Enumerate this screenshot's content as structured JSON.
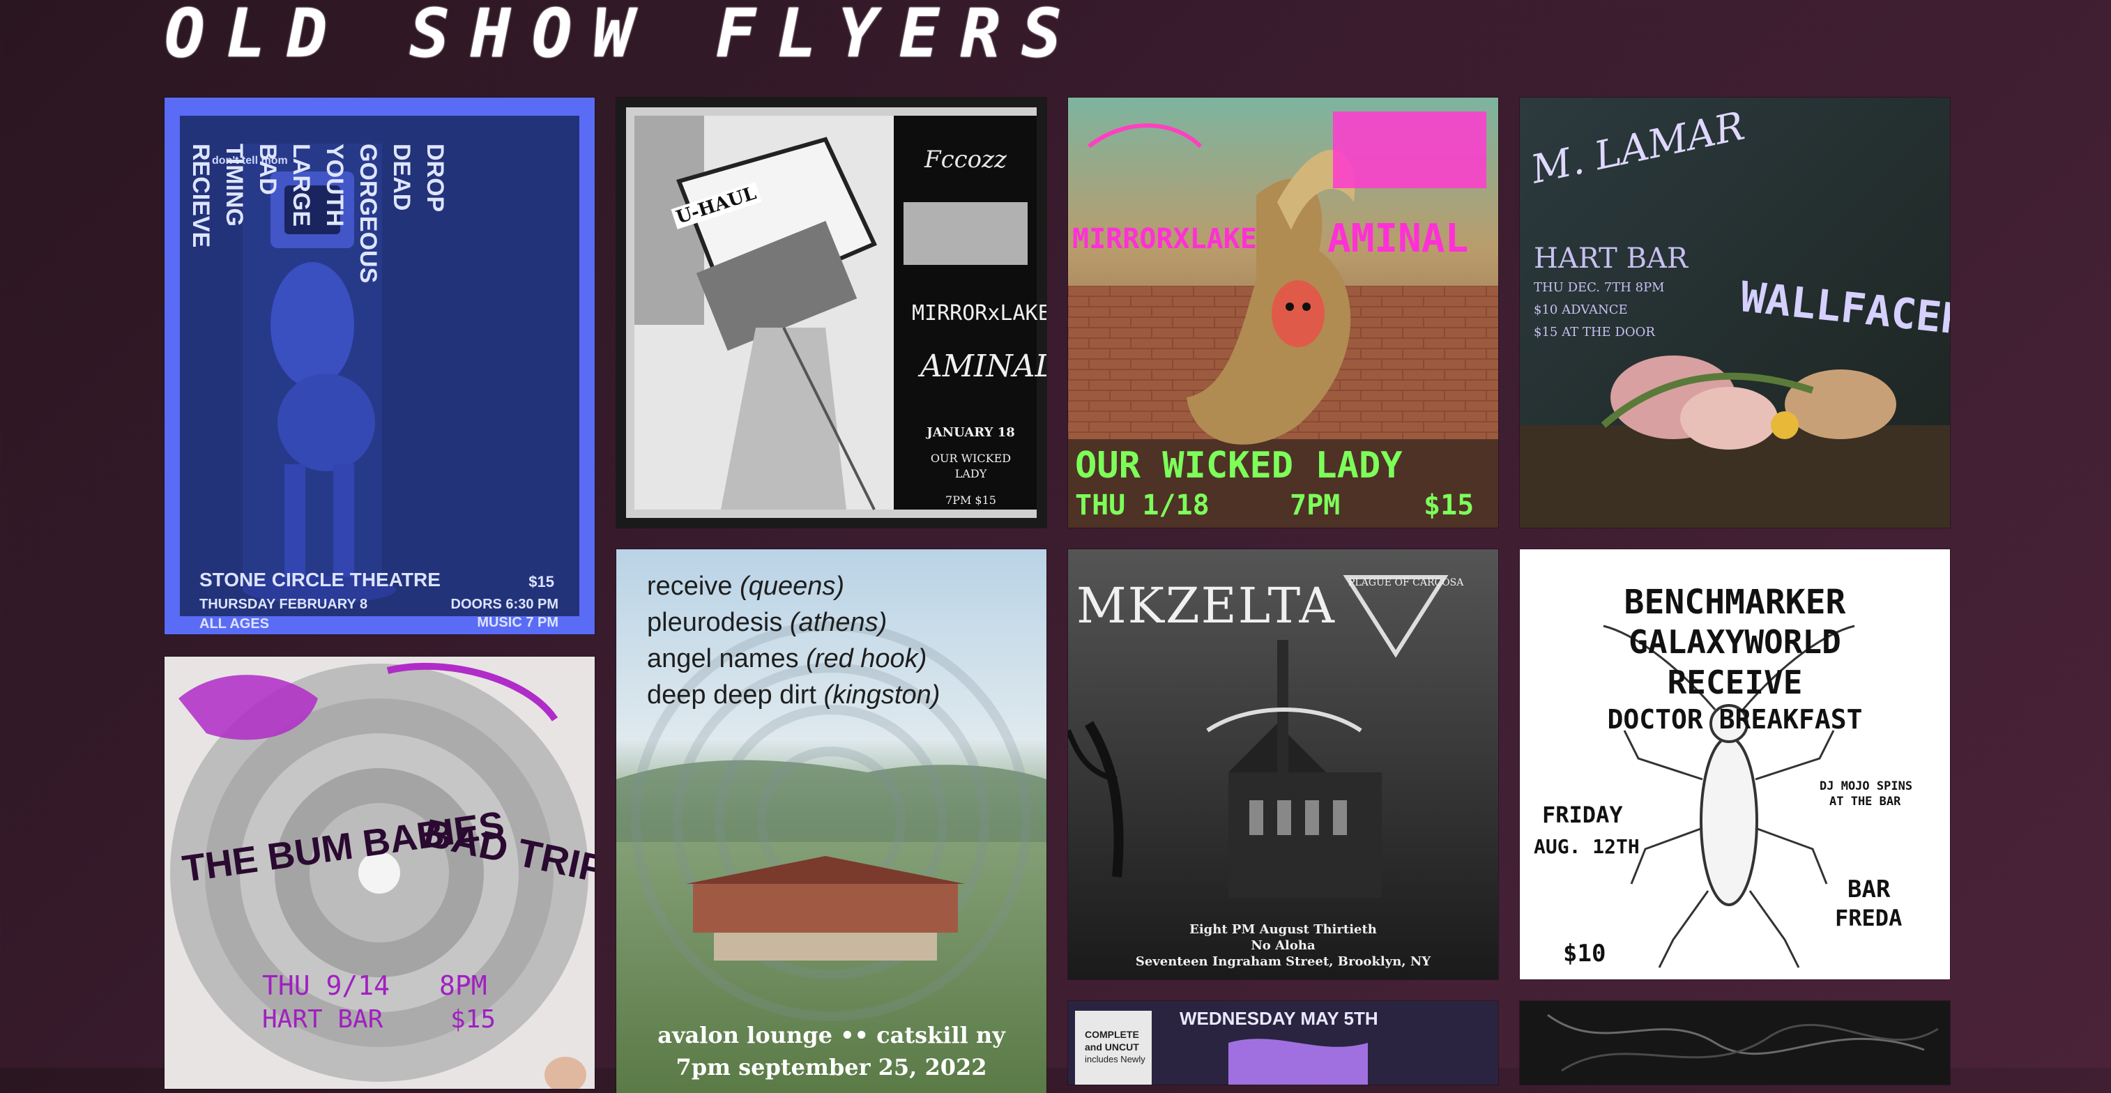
{
  "page": {
    "title": "OLD SHOW FLYERS"
  },
  "flyers": [
    {
      "id": "flyer-1",
      "logo": "don't tell mom",
      "bands": [
        "DROP DEAD GORGEOUS",
        "YOUTH LARGE",
        "BAD TIMING",
        "RECIEVE"
      ],
      "venue": "STONE CIRCLE THEATRE",
      "date": "THURSDAY FEBRUARY 8",
      "ages": "ALL AGES",
      "price": "$15",
      "doors": "DOORS 6:30 PM",
      "music": "MUSIC 7 PM"
    },
    {
      "id": "flyer-2",
      "bands": [
        "MIRRORxLAKE",
        "AMINAL"
      ],
      "van_text": "U-HAUL",
      "date": "JANUARY 18",
      "venue_line1": "OUR WICKED",
      "venue_line2": "LADY",
      "time_price": "7PM $15"
    },
    {
      "id": "flyer-3",
      "bands": [
        "MIRRORXLAKE",
        "AMINAL"
      ],
      "venue": "OUR WICKED LADY",
      "date": "THU 1/18",
      "time": "7PM",
      "price": "$15"
    },
    {
      "id": "flyer-4",
      "bands": [
        "M. LAMAR",
        "WALLFACER"
      ],
      "venue": "HART BAR",
      "date": "THU DEC. 7TH 8PM",
      "advance": "$10 ADVANCE",
      "door": "$15 AT THE DOOR"
    },
    {
      "id": "flyer-5",
      "bands": [
        "THE BUM BABIES",
        "BAD TRIPS"
      ],
      "date": "THU 9/14",
      "time": "8PM",
      "venue": "HART BAR",
      "price": "$15"
    },
    {
      "id": "flyer-6",
      "lineup": [
        {
          "band": "receive",
          "city": "(queens)"
        },
        {
          "band": "pleurodesis",
          "city": "(athens)"
        },
        {
          "band": "angel names",
          "city": "(red hook)"
        },
        {
          "band": "deep deep dirt",
          "city": "(kingston)"
        }
      ],
      "footer": "avalon lounge •• catskill ny",
      "footer2": "7pm september 25, 2022"
    },
    {
      "id": "flyer-7",
      "bands": [
        "MKZELTA",
        "PLAGUE OF CARCOSA"
      ],
      "line1": "Eight PM August Thirtieth",
      "line2": "No Aloha",
      "line3": "Seventeen Ingraham Street, Brooklyn, NY"
    },
    {
      "id": "flyer-8",
      "bands": [
        "BENCHMARKER",
        "GALAXYWORLD",
        "RECEIVE",
        "DOCTOR BREAKFAST"
      ],
      "date_line1": "FRIDAY",
      "date_line2": "AUG. 12TH",
      "dj_line1": "DJ MOJO SPINS",
      "dj_line2": "AT THE BAR",
      "venue_line1": "BAR",
      "venue_line2": "FREDA",
      "price": "$10"
    },
    {
      "id": "flyer-9",
      "header": "WEDNESDAY MAY 5TH",
      "badge_line1": "COMPLETE",
      "badge_line2": "and UNCUT",
      "badge_line3": "includes Newly"
    },
    {
      "id": "flyer-10"
    }
  ]
}
